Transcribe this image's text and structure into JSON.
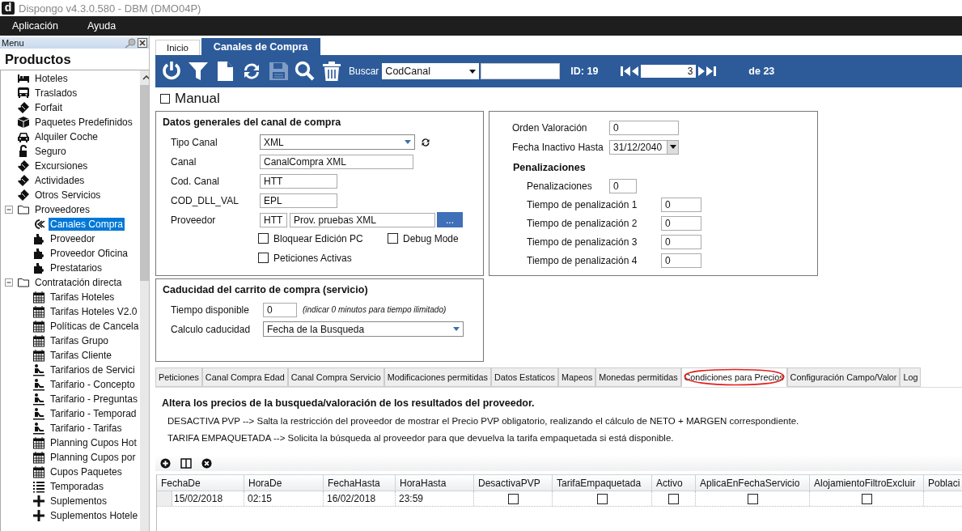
{
  "window": {
    "logo": "d",
    "title": "Dispongo v4.3.0.580 - DBM (DMO04P)"
  },
  "menu_bar": [
    "Aplicación",
    "Ayuda"
  ],
  "sidebar": {
    "header": "Menu",
    "title": "Productos",
    "items": [
      {
        "label": "Hoteles",
        "kind": "hotel",
        "selected": false
      },
      {
        "label": "Traslados",
        "kind": "transfer",
        "selected": false
      },
      {
        "label": "Forfait",
        "kind": "ticket",
        "selected": false
      },
      {
        "label": "Paquetes Predefinidos",
        "kind": "package",
        "selected": false
      },
      {
        "label": "Alquiler Coche",
        "kind": "car",
        "selected": false
      },
      {
        "label": "Seguro",
        "kind": "lock",
        "selected": false
      },
      {
        "label": "Excursiones",
        "kind": "ticket",
        "selected": false
      },
      {
        "label": "Actividades",
        "kind": "ticket",
        "selected": false
      },
      {
        "label": "Otros Servicios",
        "kind": "ticket",
        "selected": false
      },
      {
        "label": "Proveedores",
        "kind": "folder",
        "selected": false,
        "expanded": true,
        "children": [
          {
            "label": "Canales Compra",
            "kind": "channel",
            "selected": true
          },
          {
            "label": "Proveedor",
            "kind": "puzzle",
            "selected": false
          },
          {
            "label": "Proveedor Oficina",
            "kind": "puzzle",
            "selected": false
          },
          {
            "label": "Prestatarios",
            "kind": "puzzle",
            "selected": false
          }
        ]
      },
      {
        "label": "Contratación directa",
        "kind": "folder",
        "selected": false,
        "expanded": true,
        "children": [
          {
            "label": "Tarifas Hoteles",
            "kind": "calendar",
            "selected": false
          },
          {
            "label": "Tarifas Hoteles V2.0",
            "kind": "calendar",
            "selected": false
          },
          {
            "label": "Políticas de Cancela",
            "kind": "calendar",
            "selected": false
          },
          {
            "label": "Tarifas Grupo",
            "kind": "calendar",
            "selected": false
          },
          {
            "label": "Tarifas Cliente",
            "kind": "calendar",
            "selected": false
          },
          {
            "label": "Tarifarios de Servici",
            "kind": "skier",
            "selected": false
          },
          {
            "label": "Tarifario - Concepto",
            "kind": "skier",
            "selected": false
          },
          {
            "label": "Tarifario - Preguntas",
            "kind": "skier",
            "selected": false
          },
          {
            "label": "Tarifario - Temporad",
            "kind": "skier",
            "selected": false
          },
          {
            "label": "Tarifario - Tarifas",
            "kind": "skier",
            "selected": false
          },
          {
            "label": "Planning Cupos Hot",
            "kind": "calendar",
            "selected": false
          },
          {
            "label": "Planning Cupos por",
            "kind": "calendar",
            "selected": false
          },
          {
            "label": "Cupos Paquetes",
            "kind": "calendar",
            "selected": false
          },
          {
            "label": "Temporadas",
            "kind": "list",
            "selected": false
          },
          {
            "label": "Suplementos",
            "kind": "plus",
            "selected": false
          },
          {
            "label": "Suplementos Hotele",
            "kind": "plus",
            "selected": false
          }
        ]
      }
    ]
  },
  "tabs": [
    {
      "label": "Inicio",
      "selected": false
    },
    {
      "label": "Canales de Compra",
      "selected": true
    }
  ],
  "toolbar": {
    "buttons": [
      {
        "kind": "power",
        "disabled": false
      },
      {
        "kind": "filter",
        "disabled": false
      },
      {
        "kind": "new",
        "disabled": false
      },
      {
        "kind": "refresh",
        "disabled": false
      },
      {
        "kind": "save",
        "disabled": true
      },
      {
        "kind": "search",
        "disabled": false
      },
      {
        "kind": "delete",
        "disabled": false
      }
    ],
    "search_label": "Buscar",
    "search_field": "CodCanal",
    "id": "ID: 19",
    "record": "3",
    "total": "de 23"
  },
  "manual": {
    "label": "Manual",
    "checked": false
  },
  "general": {
    "title": "Datos generales del canal de compra",
    "tipo_canal": {
      "label": "Tipo Canal",
      "value": "XML"
    },
    "fields": [
      {
        "label": "Canal",
        "value": "CanalCompra XML",
        "kind": "wide"
      },
      {
        "label": "Cod. Canal",
        "value": "HTT",
        "kind": "short"
      },
      {
        "label": "COD_DLL_VAL",
        "value": "EPL",
        "kind": "short"
      }
    ],
    "proveedor": {
      "label": "Proveedor",
      "code": "HTT",
      "name": "Prov. pruebas XML",
      "button": "..."
    },
    "checks": [
      {
        "label": "Bloquear Edición PC",
        "checked": false
      },
      {
        "label": "Debug Mode",
        "checked": false
      },
      {
        "label": "Peticiones Activas",
        "checked": false
      }
    ]
  },
  "valoracion": {
    "orden": {
      "label": "Orden Valoración",
      "value": "0"
    },
    "fecha": {
      "label": "Fecha Inactivo Hasta",
      "value": "31/12/2040"
    },
    "penal_title": "Penalizaciones",
    "penal": {
      "label": "Penalizaciones",
      "value": "0"
    },
    "tiempos": [
      {
        "label": "Tiempo de penalización 1",
        "value": "0"
      },
      {
        "label": "Tiempo de penalización 2",
        "value": "0"
      },
      {
        "label": "Tiempo de penalización 3",
        "value": "0"
      },
      {
        "label": "Tiempo de penalización 4",
        "value": "0"
      }
    ]
  },
  "caducidad": {
    "title": "Caducidad del carrito de compra (servicio)",
    "tiempo": {
      "label": "Tiempo disponible",
      "value": "0",
      "hint": "(indicar 0 minutos para tiempo ilimitado)"
    },
    "calculo": {
      "label": "Calculo caducidad",
      "value": "Fecha de la Busqueda"
    }
  },
  "subtabs": [
    {
      "label": "Peticiones",
      "selected": false
    },
    {
      "label": "Canal Compra Edad",
      "selected": false
    },
    {
      "label": "Canal Compra Servicio",
      "selected": false
    },
    {
      "label": "Modificaciones permitidas",
      "selected": false
    },
    {
      "label": "Datos Estaticos",
      "selected": false
    },
    {
      "label": "Mapeos",
      "selected": false
    },
    {
      "label": "Monedas permitidas",
      "selected": false
    },
    {
      "label": "Condiciones para Precios",
      "selected": true,
      "circled": true
    },
    {
      "label": "Configuración Campo/Valor",
      "selected": false
    },
    {
      "label": "Log",
      "selected": false
    }
  ],
  "conditions": {
    "heading": "Altera los precios de la busqueda/valoración de los resultados del proveedor.",
    "lines": [
      "DESACTIVA PVP --> Salta la restricción del proveedor de mostrar el Precio PVP obligatorio, realizando el cálculo de NETO + MARGEN correspondiente.",
      "TARIFA EMPAQUETADA --> Solicita la búsqueda al proveedor para que devuelva la tarifa empaquetada si está disponible."
    ]
  },
  "table": {
    "columns": [
      {
        "label": "FechaDe",
        "kind": "text"
      },
      {
        "label": "HoraDe",
        "kind": "text"
      },
      {
        "label": "FechaHasta",
        "kind": "text"
      },
      {
        "label": "HoraHasta",
        "kind": "text"
      },
      {
        "label": "DesactivaPVP",
        "kind": "check"
      },
      {
        "label": "TarifaEmpaquetada",
        "kind": "check"
      },
      {
        "label": "Activo",
        "kind": "check"
      },
      {
        "label": "AplicaEnFechaServicio",
        "kind": "check"
      },
      {
        "label": "AlojamientoFiltroExcluir",
        "kind": "check"
      },
      {
        "label": "Poblaci",
        "kind": "text"
      }
    ],
    "rows": [
      {
        "cells": [
          "15/02/2018",
          "02:15",
          "16/02/2018",
          "23:59",
          false,
          false,
          false,
          false,
          false
        ]
      }
    ]
  }
}
